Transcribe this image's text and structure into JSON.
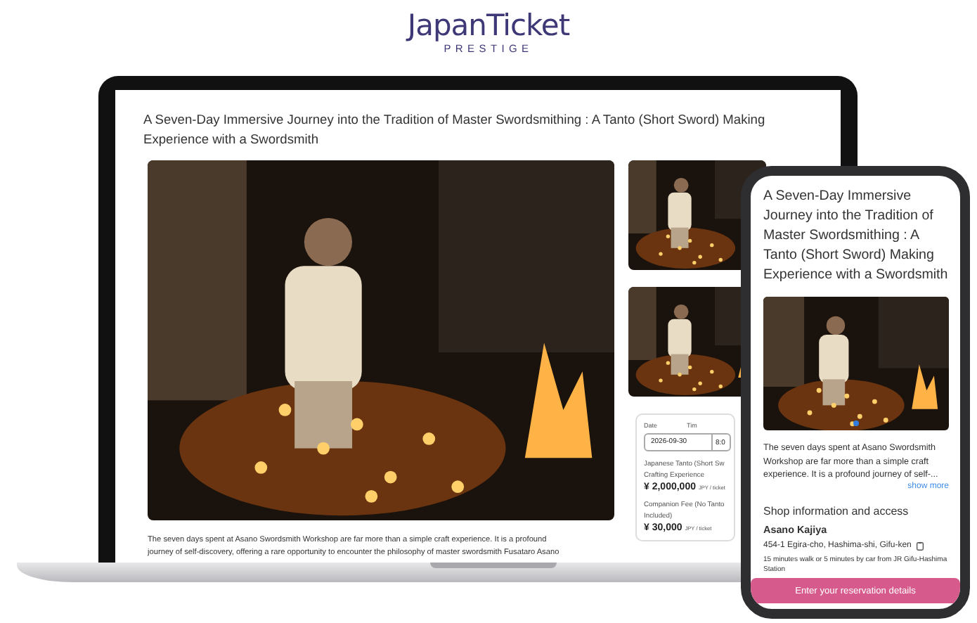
{
  "logo": {
    "wordmark": "JapanTicket",
    "tagline": "PRESTIGE"
  },
  "laptop": {
    "title": "A Seven-Day Immersive Journey into the Tradition of Master Swordsmithing : A Tanto (Short Sword) Making Experience with a Swordsmith",
    "description": "The seven days spent at Asano Swordsmith Workshop are far more than a simple craft experience. It is a profound journey of self-discovery, offering a rare opportunity to encounter the philosophy of master swordsmith Fusataro Asano",
    "booking": {
      "date_label": "Date",
      "time_label": "Tim",
      "date": "2026-09-30",
      "time": "8:0",
      "prices": [
        {
          "name": "Japanese Tanto (Short Sw\nCrafting Experience",
          "amount": "¥ 2,000,000",
          "unit": "JPY / ticket"
        },
        {
          "name": "Companion Fee (No Tanto\nIncluded)",
          "amount": "¥ 30,000",
          "unit": "JPY / ticket"
        }
      ]
    }
  },
  "phone": {
    "title": "A Seven-Day Immersive Journey into the Tradition of Master Swordsmithing : A Tanto (Short Sword) Making Experience with a Swordsmith",
    "description": "The seven days spent at Asano Swordsmith Workshop are far more than a simple craft experience. It is a profound journey of self-...",
    "show_more": "show more",
    "section_title": "Shop information and access",
    "shop_name": "Asano Kajiya",
    "address": "454-1 Egira-cho, Hashima-shi, Gifu-ken",
    "access": "15 minutes walk or 5 minutes by car from JR Gifu-Hashima Station",
    "button": "Enter your reservation details"
  }
}
